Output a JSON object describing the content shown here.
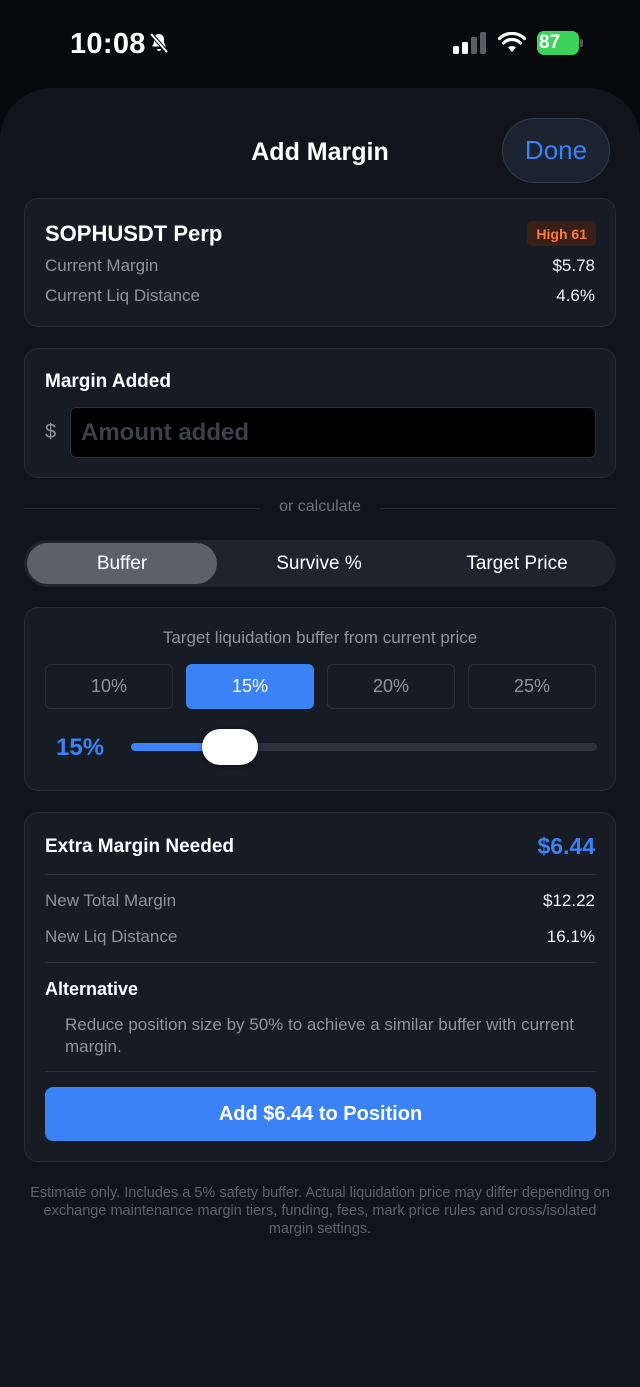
{
  "status_bar": {
    "time": "10:08",
    "battery": "87"
  },
  "sheet": {
    "title": "Add Margin",
    "done_label": "Done"
  },
  "position": {
    "symbol": "SOPHUSDT Perp",
    "risk_badge": "High 61",
    "rows": [
      {
        "label": "Current Margin",
        "value": "$5.78"
      },
      {
        "label": "Current Liq Distance",
        "value": "4.6%"
      }
    ]
  },
  "margin_added": {
    "title": "Margin Added",
    "currency": "$",
    "placeholder": "Amount added",
    "value": ""
  },
  "divider_text": "or calculate",
  "modes": [
    {
      "label": "Buffer",
      "active": true
    },
    {
      "label": "Survive %",
      "active": false
    },
    {
      "label": "Target Price",
      "active": false
    }
  ],
  "buffer": {
    "title": "Target liquidation buffer from current price",
    "presets": [
      "10%",
      "15%",
      "20%",
      "25%"
    ],
    "selected": "15%",
    "slider_label": "15%",
    "slider_fraction": 0.2
  },
  "result": {
    "title": "Extra Margin Needed",
    "amount": "$6.44",
    "rows": [
      {
        "label": "New Total Margin",
        "value": "$12.22"
      },
      {
        "label": "New Liq Distance",
        "value": "16.1%"
      }
    ],
    "alternative_title": "Alternative",
    "alternative_text": "Reduce position size by 50% to achieve a similar buffer with current margin.",
    "button_label": "Add $6.44 to Position"
  },
  "disclaimer": "Estimate only. Includes a 5% safety buffer. Actual liquidation price may differ depending on exchange maintenance margin tiers, funding, fees, mark price rules and cross/isolated margin settings.",
  "colors": {
    "accent": "#3b82f6",
    "risk": "#ff7a3c",
    "battery": "#3cd35b"
  }
}
